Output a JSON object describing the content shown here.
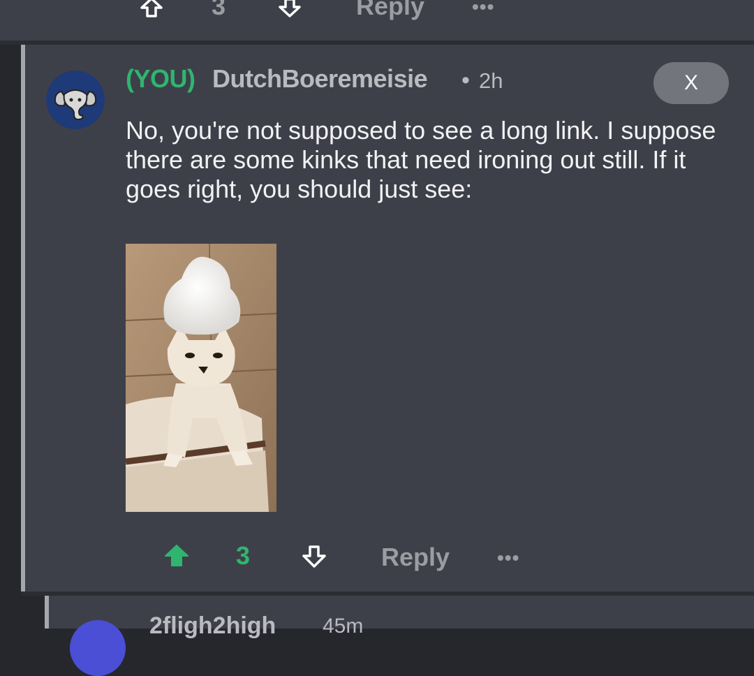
{
  "prev_comment": {
    "vote_count": "3",
    "reply_label": "Reply",
    "more_label": "•••"
  },
  "comment": {
    "you_tag": "(YOU)",
    "username": "DutchBoeremeisie",
    "separator": "•",
    "time": "2h",
    "close_label": "X",
    "body": "No, you're not supposed to see a long link. I suppose there are some kinks that need ironing out still. If it goes right, you should just see:",
    "vote_count": "3",
    "reply_label": "Reply",
    "more_label": "•••",
    "avatar_icon": "elephant-icon",
    "colors": {
      "accent_green": "#2fb56f",
      "card_bg": "#3e4049",
      "avatar_bg": "#1f3a78"
    }
  },
  "next_comment": {
    "username": "2fligh2high",
    "time": "45m"
  }
}
